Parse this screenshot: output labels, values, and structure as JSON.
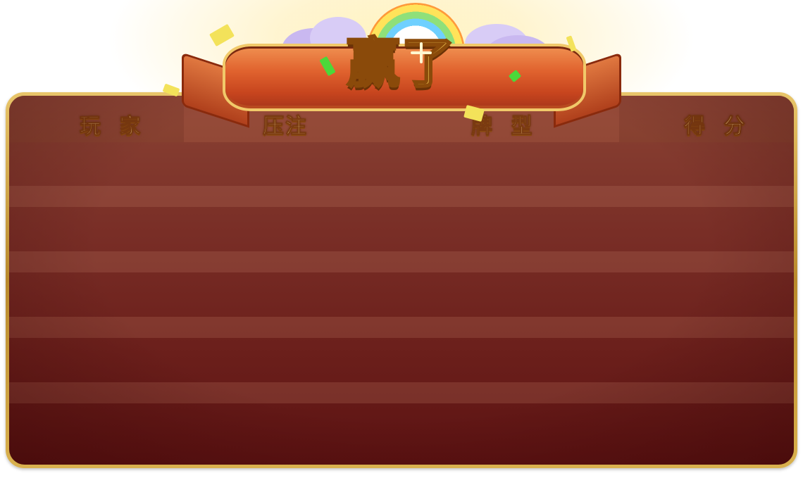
{
  "title": "赢了",
  "columns": {
    "player": "玩 家",
    "bet": "压注",
    "hand": "牌 型",
    "score": "得 分"
  },
  "colors": {
    "panel_border": "#d9b14e",
    "panel_top": "#8b4334",
    "panel_bottom": "#5c1212",
    "header_text": "#ffe39a",
    "title_text": "#ffd75a"
  }
}
